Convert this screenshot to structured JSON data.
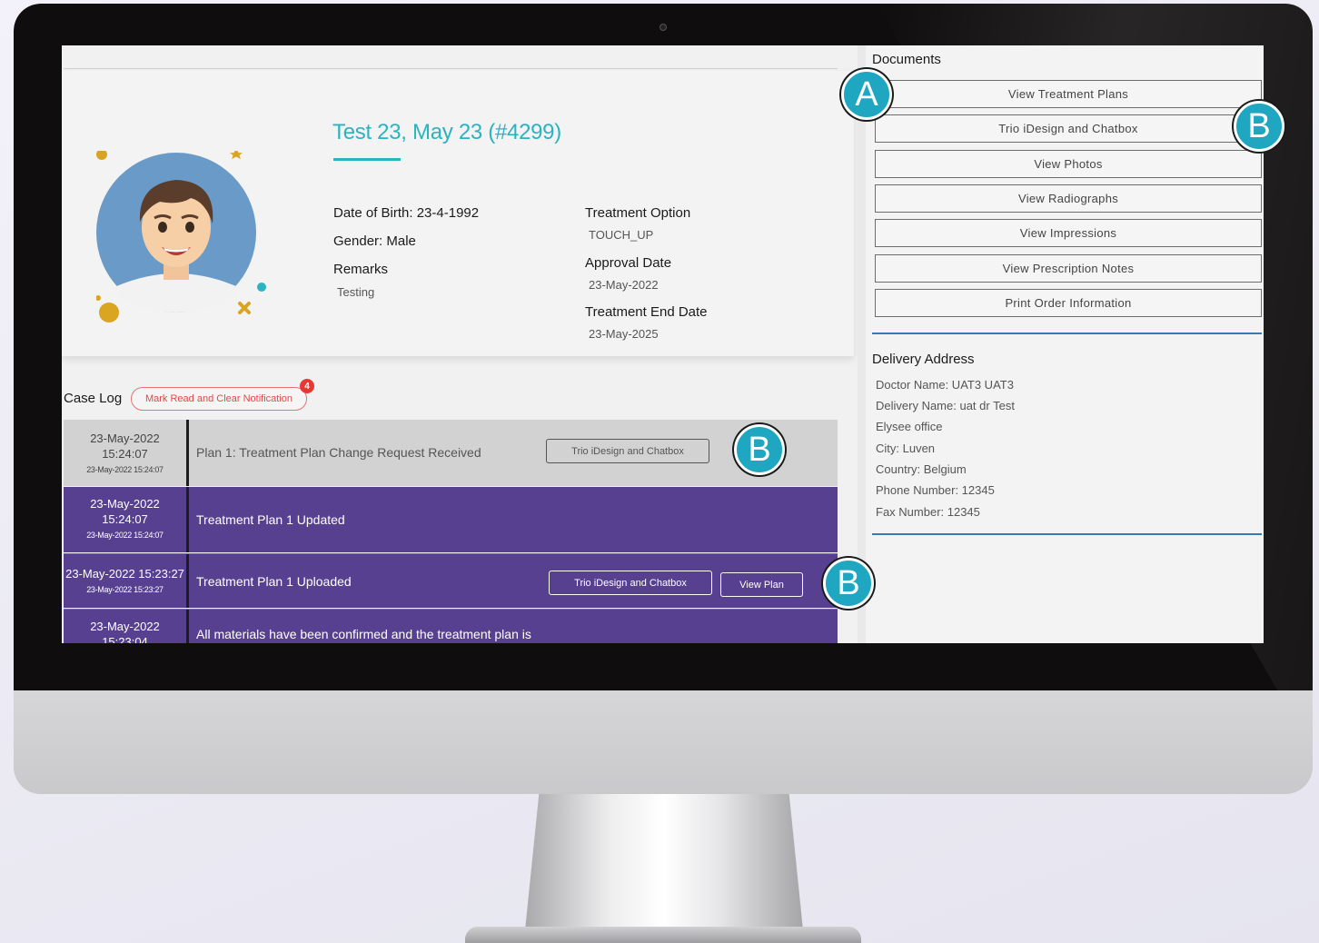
{
  "patient": {
    "name": "Test 23, May 23 (#4299)",
    "dob": "Date of Birth: 23-4-1992",
    "gender": "Gender: Male",
    "remarks_label": "Remarks",
    "remarks_value": "Testing",
    "treatment_option_label": "Treatment Option",
    "treatment_option_value": "TOUCH_UP",
    "approval_date_label": "Approval Date",
    "approval_date_value": "23-May-2022",
    "treatment_end_label": "Treatment End Date",
    "treatment_end_value": "23-May-2025"
  },
  "case_log": {
    "title": "Case Log",
    "mark_read_label": "Mark Read and Clear Notification",
    "badge_count": "4",
    "rows": [
      {
        "date": "23-May-2022",
        "time": "15:24:07",
        "small": "23-May-2022 15:24:07",
        "message": "Plan 1: Treatment Plan Change Request Received",
        "button": "Trio iDesign and Chatbox"
      },
      {
        "date": "23-May-2022",
        "time": "15:24:07",
        "small": "23-May-2022 15:24:07",
        "message": "Treatment Plan 1 Updated"
      },
      {
        "date": "23-May-2022 15:23:27",
        "small": "23-May-2022 15:23:27",
        "message": "Treatment Plan 1 Uploaded",
        "button": "Trio iDesign and Chatbox",
        "button2": "View Plan"
      },
      {
        "date": "23-May-2022",
        "time": "15:23:04",
        "message": "All materials have been confirmed and the treatment plan is"
      }
    ]
  },
  "documents": {
    "title": "Documents",
    "buttons": [
      "View Treatment Plans",
      "Trio iDesign and Chatbox",
      "View Photos",
      "View Radiographs",
      "View Impressions",
      "View Prescription Notes",
      "Print Order Information"
    ]
  },
  "delivery": {
    "title": "Delivery Address",
    "lines": [
      "Doctor Name: UAT3 UAT3",
      "Delivery Name: uat dr Test",
      "Elysee office",
      "City: Luven",
      "Country: Belgium",
      "Phone Number: 12345",
      "Fax Number: 12345"
    ]
  },
  "markers": {
    "a": "A",
    "b": "B"
  },
  "colors": {
    "accent_teal": "#2ab3c0",
    "log_purple": "#574090",
    "rule_blue": "#3a78b0",
    "marker": "#1fa6c0",
    "badge_red": "#e53935"
  }
}
